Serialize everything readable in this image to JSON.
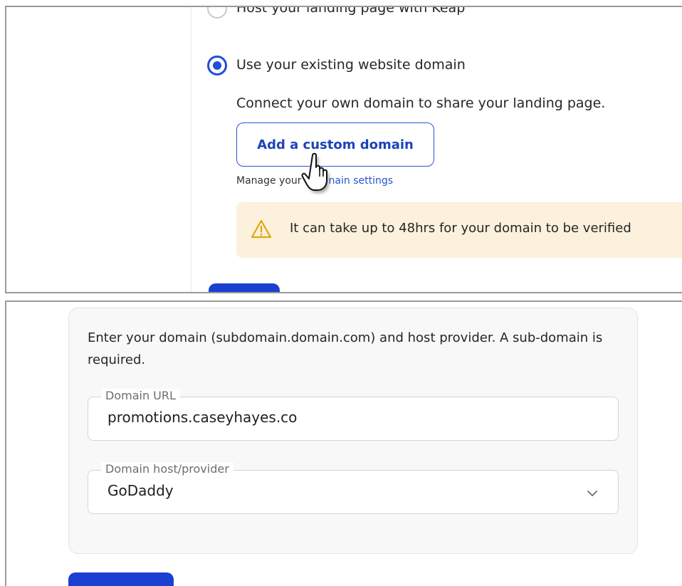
{
  "top_panel": {
    "option_host_label": "Host your landing page with Keap",
    "option_existing_label": "Use your existing website domain",
    "option_existing_selected": true,
    "description": "Connect your own domain to share your landing page.",
    "add_domain_button": "Add a custom domain",
    "manage_prefix": "Manage your",
    "manage_link": "nain settings",
    "alert_text": "It can take up to 48hrs for your domain to be verified",
    "icons": [
      "radio-icon",
      "pointer-cursor-icon",
      "warning-icon"
    ],
    "colors": {
      "accent": "#1f4fd6",
      "alert_bg": "#fbf1dc",
      "warning": "#e0a50e"
    }
  },
  "bottom_panel": {
    "description": "Enter your domain (subdomain.domain.com) and host provider. A sub-domain is required.",
    "domain_url_label": "Domain URL",
    "domain_url_value": "promotions.caseyhayes.co",
    "host_label": "Domain host/provider",
    "host_value": "GoDaddy",
    "icons": [
      "chevron-down-icon"
    ]
  }
}
